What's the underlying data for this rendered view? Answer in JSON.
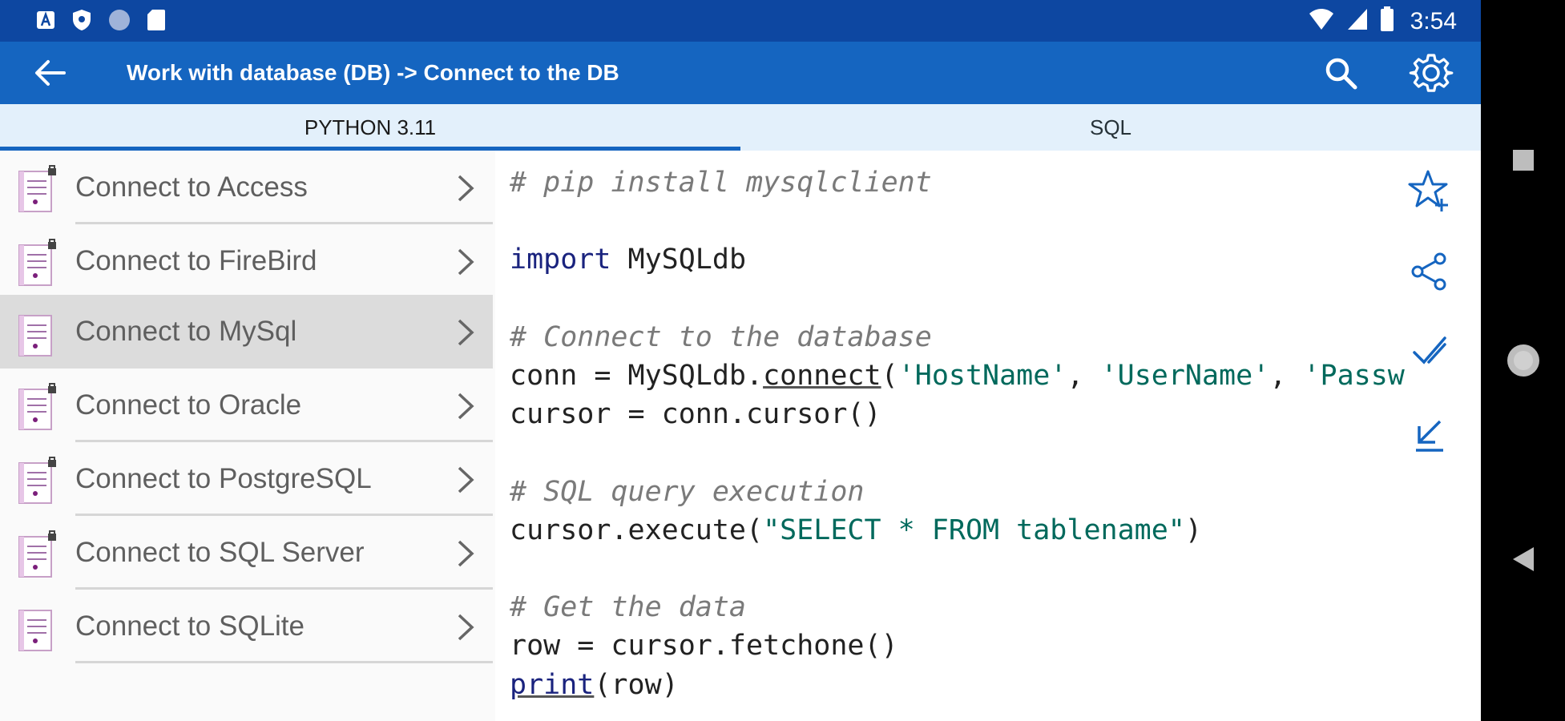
{
  "statusbar": {
    "time": "3:54"
  },
  "appbar": {
    "title": "Work with database (DB) -> Connect to the DB"
  },
  "tabs": [
    {
      "label": "PYTHON 3.11",
      "selected": true
    },
    {
      "label": "SQL",
      "selected": false
    }
  ],
  "list": {
    "items": [
      {
        "label": "Connect to Access",
        "locked": true
      },
      {
        "label": "Connect to FireBird",
        "locked": true
      },
      {
        "label": "Connect to MySql",
        "locked": false,
        "selected": true
      },
      {
        "label": "Connect to Oracle",
        "locked": true
      },
      {
        "label": "Connect to PostgreSQL",
        "locked": true
      },
      {
        "label": "Connect to SQL Server",
        "locked": true
      },
      {
        "label": "Connect to SQLite",
        "locked": false
      }
    ]
  },
  "code": {
    "lines": {
      "c1": "# pip install mysqlclient",
      "kw_import": "import",
      "mod": " MySQLdb",
      "c2": "# Connect to the database",
      "l_conn_a": "conn = MySQLdb.",
      "l_conn_fn": "connect",
      "l_conn_b": "(",
      "s_host": "'HostName'",
      "sep1": ", ",
      "s_user": "'UserName'",
      "sep2": ", ",
      "s_pass": "'Passw",
      "l_cursor": "cursor = conn.cursor()",
      "c3": "# SQL query execution",
      "l_exec_a": "cursor.execute(",
      "s_query": "\"SELECT * FROM tablename\"",
      "l_exec_b": ")",
      "c4": "# Get the data",
      "l_fetch": "row = cursor.fetchone()",
      "l_print_fn": "print",
      "l_print_b": "(row)"
    }
  },
  "icons": {
    "status_left": [
      "a-icon",
      "shield-icon",
      "circle-icon",
      "sd-card-icon"
    ],
    "status_right": [
      "wifi-icon",
      "signal-icon",
      "battery-icon"
    ],
    "side_actions": [
      "star-add-icon",
      "share-icon",
      "check-icon",
      "collapse-icon"
    ]
  },
  "colors": {
    "statusbar": "#0d47a1",
    "appbar": "#1565c0",
    "tabs_bg": "#e3f0fb",
    "accent": "#1565c0"
  }
}
